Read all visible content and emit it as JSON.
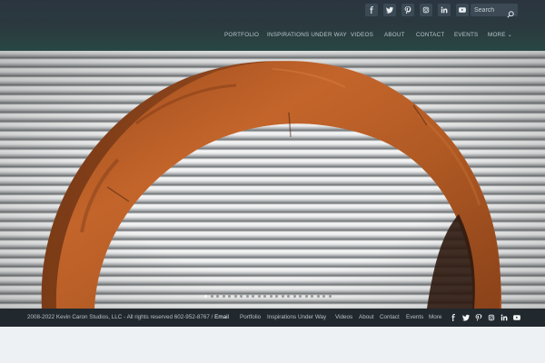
{
  "header": {
    "social": [
      "facebook-icon",
      "twitter-icon",
      "pinterest-icon",
      "instagram-icon",
      "linkedin-icon",
      "youtube-icon"
    ],
    "search_placeholder": "Search",
    "nav": [
      "PORTFOLIO",
      "INSPIRATIONS UNDER WAY",
      "VIDEOS",
      "ABOUT",
      "CONTACT",
      "EVENTS",
      "MORE"
    ]
  },
  "hero": {
    "slide_count": 22,
    "active_slide": 1,
    "colors": {
      "rust": "#b35a21",
      "rust_dark": "#5a2c12"
    }
  },
  "footer": {
    "copyright": "2008-2022 Kevin Caron Studios, LLC - All rights reserved 602-952-8767 / ",
    "email_label": "Email",
    "nav": [
      "Portfolio",
      "Inspirations Under Way",
      "Videos",
      "About",
      "Contact",
      "Events",
      "More"
    ],
    "social": [
      "facebook-icon",
      "twitter-icon",
      "pinterest-icon",
      "instagram-icon",
      "linkedin-icon",
      "youtube-icon"
    ]
  }
}
